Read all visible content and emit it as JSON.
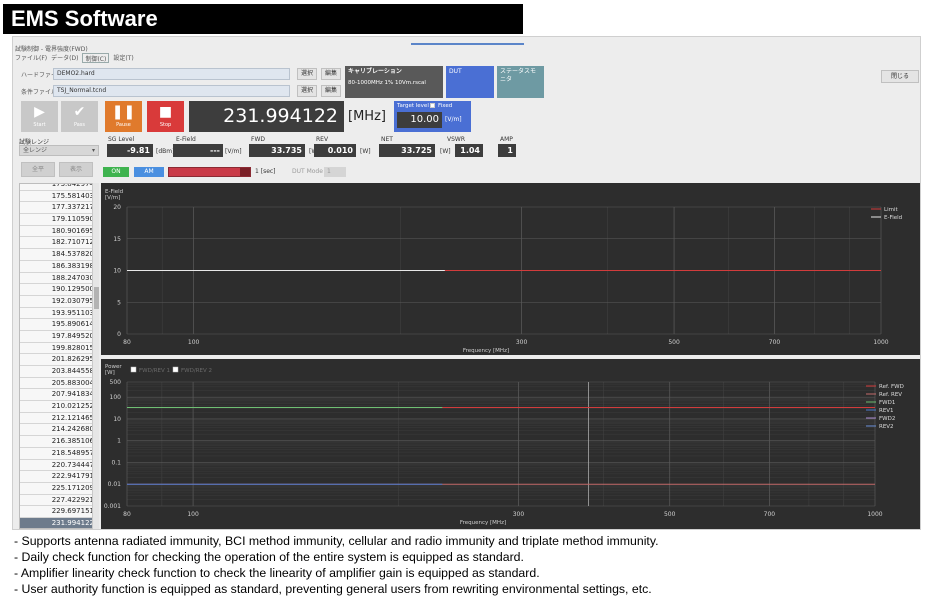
{
  "banner": {
    "title": "EMS Software"
  },
  "window": {
    "title": "試験制御 - 電界強度(FWD)",
    "menu": [
      "ファイル(F)",
      "データ(D)",
      "制御(C)",
      "設定(T)"
    ],
    "close_label": "閉じる"
  },
  "files": {
    "hard_label": "ハードファイル",
    "hard_value": "DEMO2.hard",
    "cond_label": "条件ファイル",
    "cond_value": "TSJ_Normal.tcnd",
    "select_label": "選択",
    "edit_label": "編集"
  },
  "tiles": {
    "calibration_title": "キャリブレーション",
    "calibration_value": "80-1000MHz 1% 10Vm.rscal",
    "dut_label": "DUT",
    "status_monitor_label": "ステータスモニタ"
  },
  "controls": {
    "start_label": "Start",
    "pass_label": "Pass",
    "pause_label": "Pause",
    "stop_label": "Stop",
    "frequency": "231.994122",
    "frequency_unit": "[MHz]",
    "target_level_label": "Target level",
    "fixed_label": "Fixed",
    "target_level_value": "10.00",
    "target_level_unit": "[V/m]"
  },
  "range": {
    "label": "試験レンジ",
    "value": "全レンジ",
    "btn1": "全平",
    "btn2": "表示"
  },
  "readouts": [
    {
      "label": "SG Level",
      "value": "-9.81",
      "unit": "[dBm]"
    },
    {
      "label": "E-Field",
      "value": "---",
      "unit": "[V/m]"
    },
    {
      "label": "FWD",
      "value": "33.735",
      "unit": "[W]"
    },
    {
      "label": "REV",
      "value": "0.010",
      "unit": "[W]"
    },
    {
      "label": "NET",
      "value": "33.725",
      "unit": "[W]"
    },
    {
      "label": "VSWR",
      "value": "1.04",
      "unit": ""
    },
    {
      "label": "AMP",
      "value": "1",
      "unit": ""
    }
  ],
  "status_row": {
    "on_label": "ON",
    "am_label": "AM",
    "dwell_label": "1 [sec]",
    "dut_mode_label": "DUT Mode",
    "dut_mode_value": "1"
  },
  "frequency_list": {
    "items": [
      "173.842974",
      "175.581403",
      "177.337217",
      "179.110590",
      "180.901695",
      "182.710712",
      "184.537820",
      "186.383198",
      "188.247030",
      "190.129500",
      "192.030795",
      "193.951103",
      "195.890614",
      "197.849520",
      "199.828015",
      "201.826295",
      "203.844558",
      "205.883004",
      "207.941834",
      "210.021252",
      "212.121465",
      "214.242680",
      "216.385106",
      "218.548957",
      "220.734447",
      "222.941791",
      "225.171209",
      "227.422921",
      "229.697151",
      "231.994122"
    ],
    "selected_index": 29
  },
  "colors": {
    "chart_bg": "#2d2d2d",
    "grid": "#5a5a5a",
    "limit_red": "#d23c3c",
    "efield_white": "#e8e8e8",
    "fwd_green": "#6fbf73",
    "rev_blue": "#4a7bd0",
    "accent_blue": "#4a6fd4",
    "pause_orange": "#e07a2c",
    "stop_red": "#d93a3a"
  },
  "chart_data": [
    {
      "type": "line",
      "title": "",
      "ylabel": "E-Field [V/m]",
      "xlabel": "Frequency [MHz]",
      "x_scale": "log",
      "xlim": [
        80,
        1000
      ],
      "ylim": [
        0,
        20
      ],
      "x_ticks": [
        "80",
        "100",
        "300",
        "500",
        "700",
        "1000"
      ],
      "y_ticks": [
        "0",
        "5",
        "10",
        "15",
        "20"
      ],
      "legend_position": "top-right",
      "grid": true,
      "series": [
        {
          "name": "Limit",
          "color": "#d23c3c",
          "x": [
            80,
            1000
          ],
          "y": [
            10,
            10
          ]
        },
        {
          "name": "E-Field",
          "color": "#e8e8e8",
          "x": [
            80,
            231.994122
          ],
          "y": [
            10,
            10
          ]
        }
      ]
    },
    {
      "type": "line",
      "title": "",
      "ylabel": "Power [W]",
      "xlabel": "Frequency [MHz]",
      "x_scale": "log",
      "y_scale": "log",
      "xlim": [
        80,
        1000
      ],
      "ylim": [
        0.001,
        500
      ],
      "x_ticks": [
        "80",
        "100",
        "300",
        "500",
        "700",
        "1000"
      ],
      "y_ticks": [
        "0.001",
        "0.01",
        "0.1",
        "1",
        "10",
        "100",
        "500"
      ],
      "checkboxes": [
        "FWD/REV 1",
        "FWD/REV 2"
      ],
      "legend_position": "top-right",
      "grid": true,
      "cursor_x": 380,
      "series": [
        {
          "name": "Ref. FWD",
          "color": "#d23c3c",
          "x": [
            80,
            1000
          ],
          "y": [
            33.7,
            33.7
          ]
        },
        {
          "name": "Ref. REV",
          "color": "#c46a6a",
          "x": [
            80,
            1000
          ],
          "y": [
            0.01,
            0.01
          ]
        },
        {
          "name": "FWD1",
          "color": "#6fbf73",
          "x": [
            80,
            231.994122
          ],
          "y": [
            33.7,
            33.7
          ]
        },
        {
          "name": "REV1",
          "color": "#4a7bd0",
          "x": [
            80,
            231.994122
          ],
          "y": [
            0.01,
            0.01
          ]
        },
        {
          "name": "FWD2",
          "color": "#a98ad0",
          "x": [],
          "y": []
        },
        {
          "name": "REV2",
          "color": "#6a8fd8",
          "x": [],
          "y": []
        }
      ]
    }
  ],
  "description": [
    "- Supports antenna radiated immunity, BCI method immunity, cellular and radio immunity and triplate method immunity.",
    "- Daily check function for checking the operation of the entire system is equipped as standard.",
    "- Amplifier linearity check function to check the linearity of amplifier gain is equipped as standard.",
    "- User authority function is equipped as standard, preventing general users from rewriting environmental settings, etc."
  ]
}
